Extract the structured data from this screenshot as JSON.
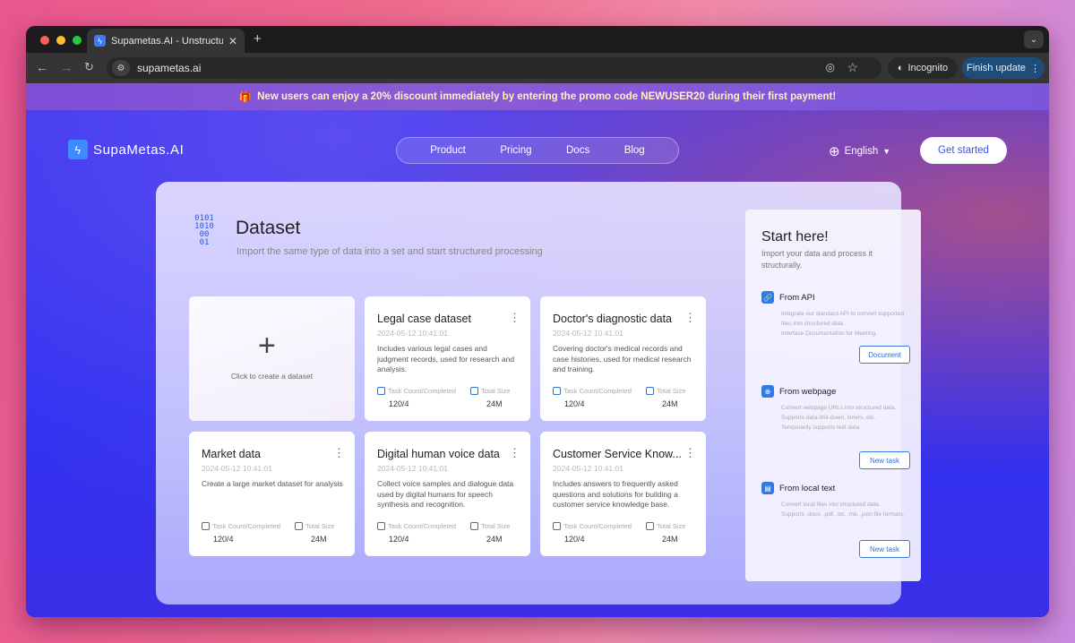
{
  "browser": {
    "tab_title": "Supametas.AI - Unstructured",
    "new_tab": "+",
    "url": "supametas.ai",
    "incognito_label": "Incognito",
    "update_label": "Finish update"
  },
  "promo": {
    "text": "New users can enjoy a 20% discount immediately by entering the promo code NEWUSER20 during their first payment!"
  },
  "nav": {
    "brand": "SupaMetas.AI",
    "items": [
      "Product",
      "Pricing",
      "Docs",
      "Blog"
    ],
    "language": "English",
    "cta": "Get started"
  },
  "dataset": {
    "icon_digits": "0101\n1010\n00\n01",
    "title": "Dataset",
    "subtitle": "Import the same type of data into a set and start structured processing",
    "create_label": "Click to create a dataset",
    "create_symbol": "+",
    "task_label": "Task Count/Completed",
    "size_label": "Total Size",
    "cards": [
      {
        "title": "Legal case dataset",
        "date": "2024-05-12 10:41:01",
        "desc": "Includes various legal cases and judgment records, used for research and analysis.",
        "tasks": "120/4",
        "size": "24M"
      },
      {
        "title": "Doctor's diagnostic data",
        "date": "2024-05-12 10:41:01",
        "desc": "Covering doctor's medical records and case histories, used for medical research and training.",
        "tasks": "120/4",
        "size": "24M"
      },
      {
        "title": "Market data",
        "date": "2024-05-12 10:41:01",
        "desc": "Create a large market dataset for analysis",
        "tasks": "120/4",
        "size": "24M"
      },
      {
        "title": "Digital human voice data",
        "date": "2024-05-12 10:41:01",
        "desc": "Collect voice samples and dialogue data used by digital humans for speech synthesis and recognition.",
        "tasks": "120/4",
        "size": "24M"
      },
      {
        "title": "Customer Service Know...",
        "date": "2024-05-12 10:41:01",
        "desc": "Includes answers to frequently asked questions and solutions for building a customer service knowledge base.",
        "tasks": "120/4",
        "size": "24M"
      }
    ]
  },
  "start": {
    "title": "Start here!",
    "subtitle": "Import your data and process it structurally.",
    "sections": [
      {
        "title": "From API",
        "desc": "Integrate our standard API to convert supported files into structured data.\nInterface Documentation for Meeting.",
        "button": "Document"
      },
      {
        "title": "From webpage",
        "desc": "Convert webpage URLs into structured data.\nSupports data drill-down, timers, etc.\nTemporarily supports text data.",
        "button": "New task"
      },
      {
        "title": "From local text",
        "desc": "Convert local files into structured data.\nSupports .docx, .pdf, .txt, .md, .json file formats.",
        "button": "New task"
      }
    ]
  },
  "colors": {
    "accent": "#2f7ae5",
    "cta_text": "#3b53e8",
    "promo_text": "#fff2c0"
  }
}
